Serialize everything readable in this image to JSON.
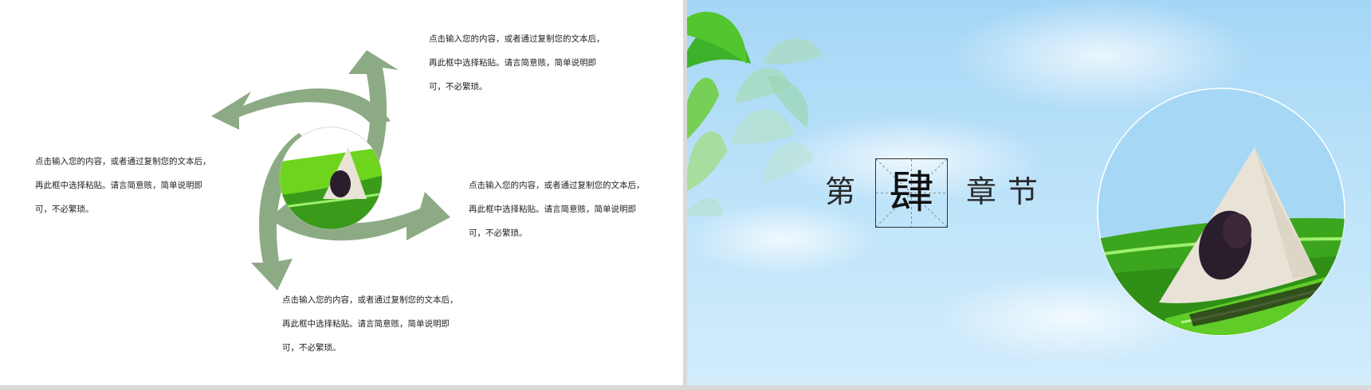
{
  "left_slide": {
    "paragraphs": [
      {
        "id": "top",
        "lines": [
          "点击输入您的内容，或者通过复制您的文本后，",
          "再此框中选择粘贴。请言简意赅，简单说明即",
          "可，不必繁琐。"
        ]
      },
      {
        "id": "left",
        "lines": [
          "点击输入您的内容，或者通过复制您的文本后，",
          "再此框中选择粘贴。请言简意赅，简单说明即",
          "可，不必繁琐。"
        ]
      },
      {
        "id": "right",
        "lines": [
          "点击输入您的内容，或者通过复制您的文本后，",
          "再此框中选择粘贴。请言简意赅，简单说明即",
          "可，不必繁琐。"
        ]
      },
      {
        "id": "bottom",
        "lines": [
          "点击输入您的内容，或者通过复制您的文本后，",
          "再此框中选择粘贴。请言简意赅，简单说明即",
          "可，不必繁琐。"
        ]
      }
    ],
    "arrow_color": "#8cab84",
    "center_image": "zongzi-on-leaf"
  },
  "right_slide": {
    "chapter_prefix": "第",
    "chapter_number": "肆",
    "chapter_suffix": "章节",
    "image": "zongzi-on-leaf",
    "decor": "green-leaves"
  },
  "colors": {
    "sky_top": "#a5d6f6",
    "sky_bottom": "#d2ecfb",
    "leaf_green": "#4cbd2e",
    "zongzi_white": "#e8e3d6",
    "bean_dark": "#2a1e2c"
  }
}
